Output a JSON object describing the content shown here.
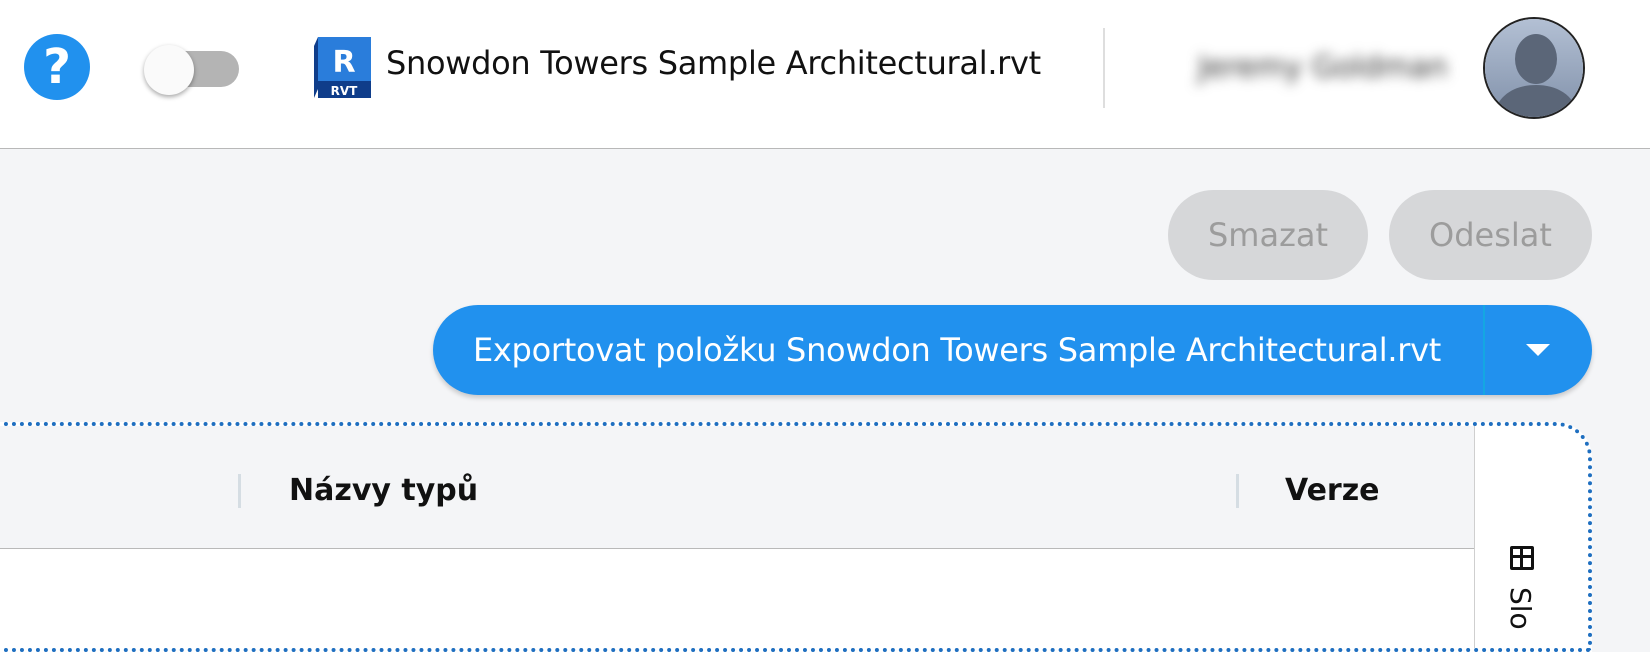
{
  "header": {
    "help_icon": "?",
    "toggle_state": "off",
    "file_icon_letter": "R",
    "file_icon_ext": "RVT",
    "file_title": "Snowdon Towers Sample Architectural.rvt",
    "user_name": "Jeremy Goldman",
    "avatar_icon": "user-silhouette-icon"
  },
  "actions": {
    "delete_label": "Smazat",
    "send_label": "Odeslat",
    "export_label": "Exportovat položku Snowdon Towers Sample Architectural.rvt"
  },
  "table": {
    "columns": [
      "Názvy typů",
      "Verze"
    ],
    "side_panel_label": "Slo"
  },
  "colors": {
    "accent": "#2191ee",
    "disabled_bg": "#d6d7d9",
    "disabled_text": "#9c9c9c",
    "rvt_blue": "#1652b6",
    "page_bg": "#f4f5f7"
  }
}
